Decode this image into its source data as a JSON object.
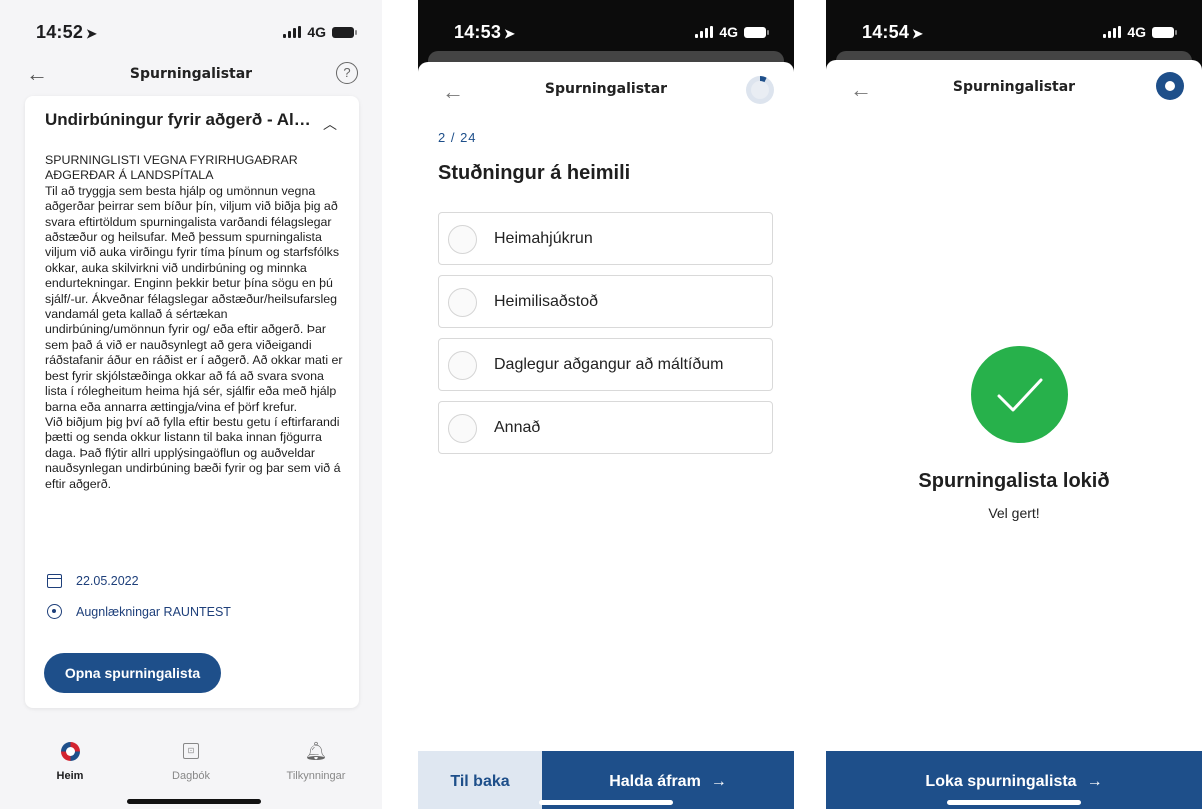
{
  "screen1": {
    "status": {
      "time": "14:52",
      "network": "4G"
    },
    "nav": {
      "title": "Spurningalistar"
    },
    "card": {
      "title": "Undirbúningur fyrir aðgerð - Almenn...",
      "intro_paragraphs": [
        "SPURNINGLISTI VEGNA FYRIRHUGAÐRAR AÐGERÐAR Á LANDSPÍTALA",
        "Til að tryggja sem besta hjálp og umönnun vegna aðgerðar þeirrar sem bíður þín, viljum við biðja þig að svara eftirtöldum spurningalista varðandi félagslegar aðstæður og heilsufar. Með þessum spurningalista viljum við auka virðingu fyrir tíma þínum og starfsfólks okkar, auka skilvirkni við undirbúning og minnka endurtekningar. Enginn þekkir betur þína sögu en þú sjálf/-ur. Ákveðnar félagslegar aðstæður/heilsufarsleg vandamál geta kallað á sértækan undirbúning/umönnun fyrir og/ eða eftir aðgerð. Þar sem það á við er nauðsynlegt að gera viðeigandi ráðstafanir áður en ráðist er í aðgerð. Að okkar mati er best fyrir skjólstæðinga okkar að fá að svara svona lista í rólegheitum heima hjá sér, sjálfir eða með hjálp barna eða annarra ættingja/vina ef þörf krefur.",
        "Við biðjum þig því að fylla eftir bestu getu í eftirfarandi þætti og senda okkur listann til baka innan fjögurra daga. Það flýtir allri upplýsingaöflun og auðveldar nauðsynlegan undirbúning bæði fyrir og þar sem við á eftir aðgerð."
      ],
      "date": "22.05.2022",
      "location": "Augnlækningar RAUNTEST",
      "open_button": "Opna spurningalista"
    },
    "tabs": [
      {
        "label": "Heim",
        "icon": "logo-icon"
      },
      {
        "label": "Dagbók",
        "icon": "book-icon"
      },
      {
        "label": "Tilkynningar",
        "icon": "bell-icon"
      }
    ]
  },
  "screen2": {
    "status": {
      "time": "14:53",
      "network": "4G"
    },
    "nav": {
      "title": "Spurningalistar"
    },
    "progress": {
      "current": 2,
      "total": 24,
      "label": "2 / 24"
    },
    "question": "Stuðningur á heimili",
    "options": [
      "Heimahjúkrun",
      "Heimilisaðstoð",
      "Daglegur aðgangur að máltíðum",
      "Annað"
    ],
    "back_button": "Til baka",
    "next_button": "Halda áfram"
  },
  "screen3": {
    "status": {
      "time": "14:54",
      "network": "4G"
    },
    "nav": {
      "title": "Spurningalistar"
    },
    "done_title": "Spurningalista lokið",
    "done_subtitle": "Vel gert!",
    "close_button": "Loka spurningalista"
  },
  "colors": {
    "accent": "#1e4f8a",
    "success": "#27b14b",
    "danger": "#d32430"
  }
}
